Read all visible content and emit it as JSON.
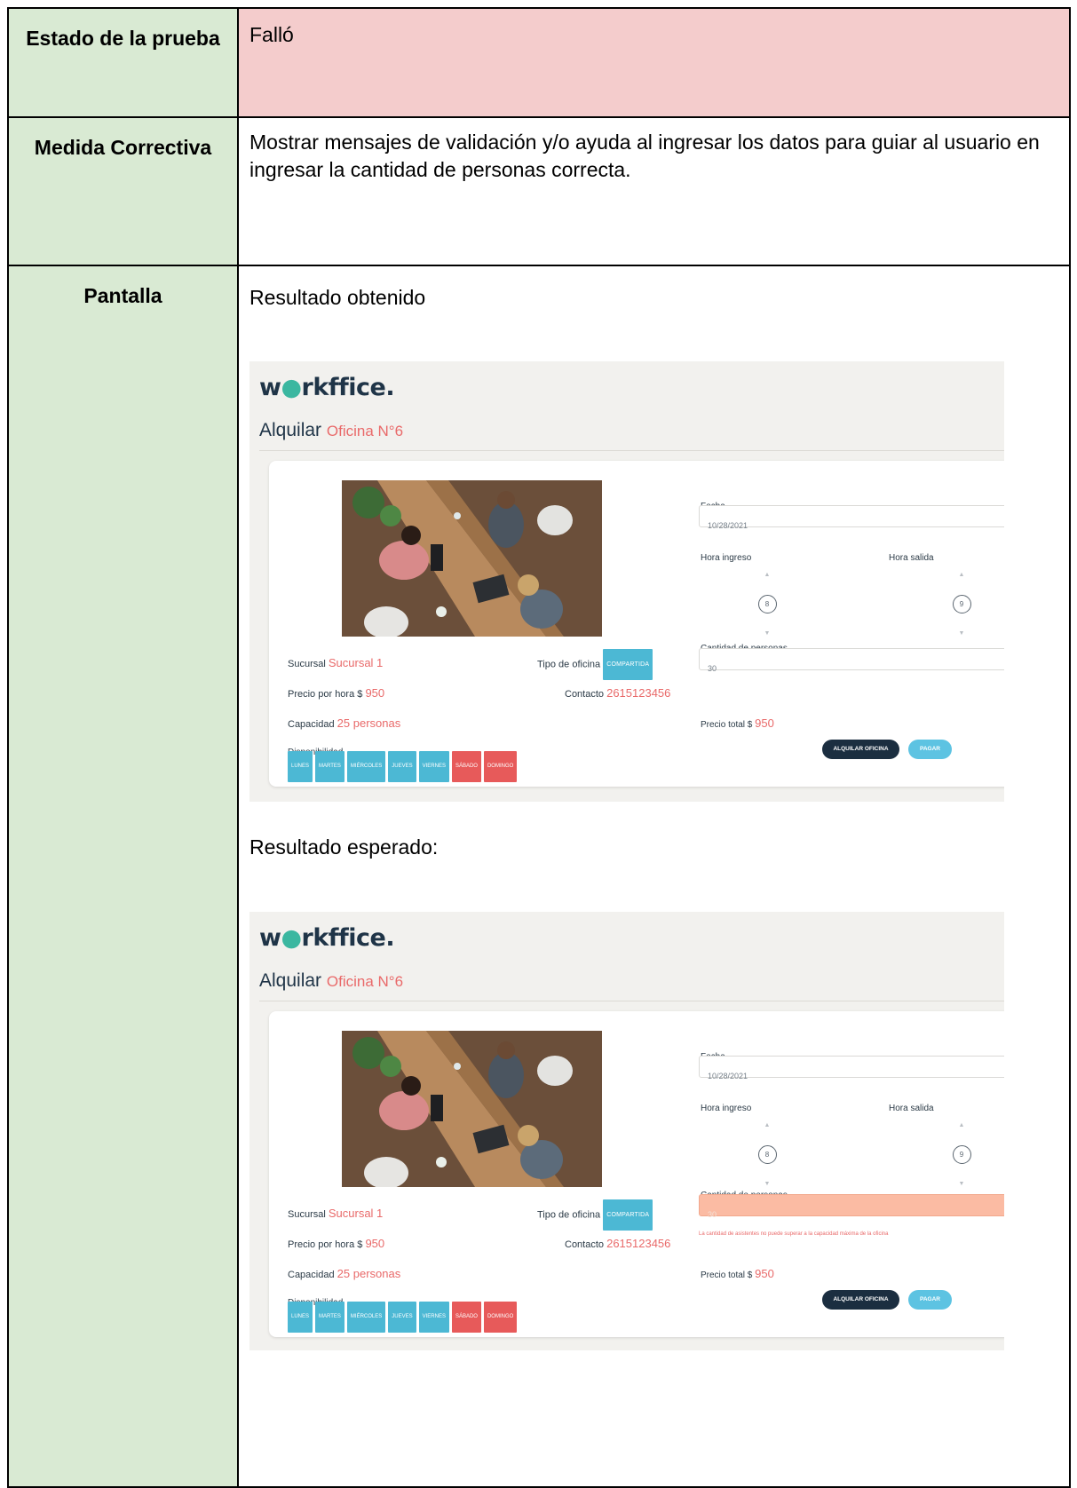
{
  "rows": {
    "estado": {
      "label": "Estado de la prueba",
      "value": "Falló"
    },
    "medida": {
      "label": "Medida Correctiva",
      "value": "Mostrar mensajes de validación y/o ayuda al ingresar los datos para guiar al usuario en ingresar la cantidad de personas correcta."
    },
    "pantalla": {
      "label": "Pantalla"
    }
  },
  "obtained": {
    "heading": "Resultado obtenido",
    "app": {
      "logo": "workffice.",
      "title": "Alquilar",
      "office": "Oficina N°6",
      "sucursal_label": "Sucursal",
      "sucursal_value": "Sucursal 1",
      "tipo_label": "Tipo de oficina",
      "tipo_value": "COMPARTIDA",
      "precio_label": "Precio por hora $",
      "precio_value": "950",
      "contacto_label": "Contacto",
      "contacto_value": "2615123456",
      "capacidad_label": "Capacidad",
      "capacidad_value": "25 personas",
      "disponibilidad_label": "Disponibilidad",
      "days": [
        "LUNES",
        "MARTES",
        "MIÉRCOLES",
        "JUEVES",
        "VIERNES",
        "SÁBADO",
        "DOMINGO"
      ],
      "fecha_label": "Fecha",
      "fecha_value": "10/28/2021",
      "hora_ingreso_label": "Hora ingreso",
      "hora_ingreso_value": "8",
      "hora_salida_label": "Hora salida",
      "hora_salida_value": "9",
      "personas_label": "Cantidad de personas",
      "personas_value": "30",
      "precio_total_label": "Precio total $",
      "precio_total_value": "950",
      "alquilar_button": "ALQUILAR OFICINA",
      "pagar_button": "PAGAR"
    }
  },
  "expected": {
    "heading": "Resultado esperado:",
    "error_message": "La cantidad de asistentes no puede superar a la capacidad máxima de la oficina"
  },
  "colors": {
    "label_bg": "#d9ead3",
    "fail_bg": "#f4cccc",
    "accent": "#e96a6a",
    "navy": "#1b2e40",
    "tag_blue": "#4cb8d4",
    "tag_red": "#e75a5a",
    "error_input": "#fbbba3"
  }
}
